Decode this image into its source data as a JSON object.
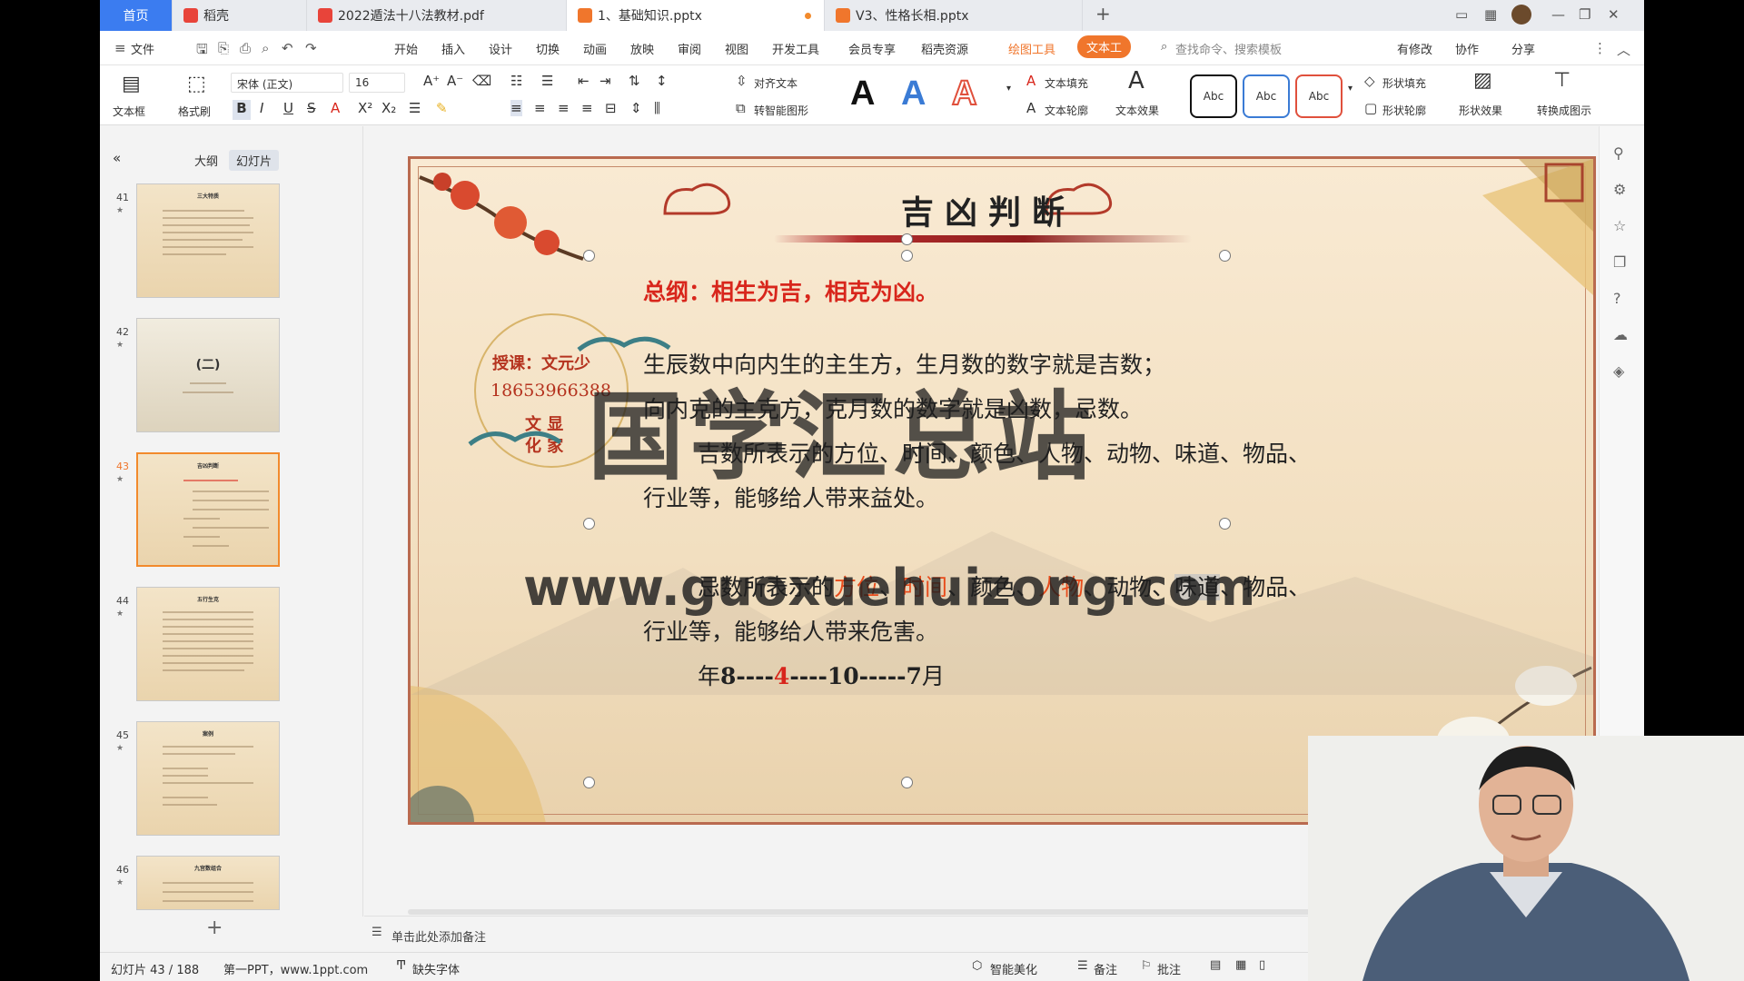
{
  "tabs": [
    {
      "label": "首页"
    },
    {
      "label": "稻壳"
    },
    {
      "label": "2022遁法十八法教材.pdf"
    },
    {
      "label": "1、基础知识.pptx"
    },
    {
      "label": "V3、性格长相.pptx"
    }
  ],
  "menu": {
    "file": "文件",
    "items": [
      "开始",
      "插入",
      "设计",
      "切换",
      "动画",
      "放映",
      "审阅",
      "视图",
      "开发工具",
      "会员专享",
      "稻壳资源"
    ],
    "drawing_tools": "绘图工具",
    "text_tools": "文本工",
    "search_placeholder": "查找命令、搜索模板",
    "has_changes": "有修改",
    "collab": "协作",
    "share": "分享"
  },
  "ribbon": {
    "textbox": "文本框",
    "format_painter": "格式刷",
    "font": "宋体 (正文)",
    "size": "16",
    "align_text": "对齐文本",
    "smart_shape": "转智能图形",
    "text_fill": "文本填充",
    "text_outline": "文本轮廓",
    "text_effect": "文本效果",
    "shape_fill": "形状填充",
    "shape_outline": "形状轮廓",
    "shape_effect": "形状效果",
    "convert_image": "转换成图示",
    "style_a": "A",
    "abc": "Abc",
    "colors": {
      "black": "#111111",
      "blue": "#3a7bd5",
      "red": "#e0503c"
    }
  },
  "left_panel": {
    "outline": "大纲",
    "slides": "幻灯片",
    "thumbs": [
      {
        "num": "41",
        "title": "三大特质"
      },
      {
        "num": "42",
        "title": "(二)"
      },
      {
        "num": "43",
        "title": "吉凶判断"
      },
      {
        "num": "44",
        "title": "五行生克"
      },
      {
        "num": "45",
        "title": "案例"
      },
      {
        "num": "46",
        "title": "九宫数组合"
      }
    ]
  },
  "slide": {
    "title": "吉凶判断",
    "summary": "总纲：相生为吉，相克为凶。",
    "teacher_label": "授课：文元少",
    "phone": "18653966388",
    "seal_text": "文 显",
    "seal_text2": "化 家",
    "line1": "生辰数中向内生的主生方，生月数的数字就是吉数；",
    "line2": "向内克的主克方，克月数的数字就是凶数，忌数。",
    "line3": "吉数所表示的方位、时间、颜色、人物、动物、味道、物品、",
    "line4": "行业等，能够给人带来益处。",
    "line5_a": "忌数所表示的",
    "line5_b": "方位",
    "line5_c": "、",
    "line5_d": "时间",
    "line5_e": "、颜色、",
    "line5_f": "人物",
    "line5_g": "、动物、",
    "line5_h": "味道",
    "line5_i": "、物品、",
    "line6": "行业等，能够给人带来危害。",
    "line7_a": "年",
    "line7_b": "8----",
    "line7_c": "4",
    "line7_d": "----10-----7",
    "line7_e": "月"
  },
  "watermark": {
    "cn": "国学汇总站",
    "url": "www.guoxuehuizong.com"
  },
  "notes": "单击此处添加备注",
  "status": {
    "slide": "幻灯片 43 / 188",
    "theme": "第一PPT，www.1ppt.com",
    "missing_font": "缺失字体",
    "beautify": "智能美化",
    "notes": "备注",
    "comment": "批注"
  }
}
